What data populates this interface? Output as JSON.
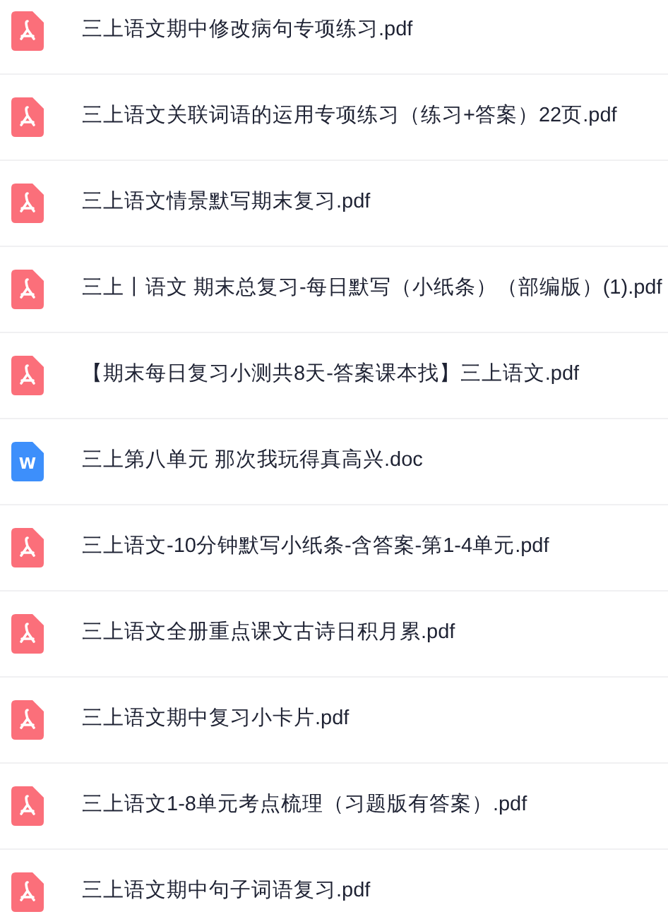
{
  "files": [
    {
      "kind": "pdf",
      "name": "三上语文期中修改病句专项练习.pdf"
    },
    {
      "kind": "pdf",
      "name": "三上语文关联词语的运用专项练习（练习+答案）22页.pdf"
    },
    {
      "kind": "pdf",
      "name": "三上语文情景默写期末复习.pdf"
    },
    {
      "kind": "pdf",
      "name": "三上丨语文 期末总复习-每日默写（小纸条）（部编版）(1).pdf"
    },
    {
      "kind": "pdf",
      "name": "【期末每日复习小测共8天-答案课本找】三上语文.pdf"
    },
    {
      "kind": "doc",
      "icon_text": "W",
      "name": "三上第八单元 那次我玩得真高兴.doc"
    },
    {
      "kind": "pdf",
      "name": "三上语文-10分钟默写小纸条-含答案-第1-4单元.pdf"
    },
    {
      "kind": "pdf",
      "name": "三上语文全册重点课文古诗日积月累.pdf"
    },
    {
      "kind": "pdf",
      "name": "三上语文期中复习小卡片.pdf"
    },
    {
      "kind": "pdf",
      "name": "三上语文1-8单元考点梳理（习题版有答案）.pdf"
    },
    {
      "kind": "pdf",
      "name": "三上语文期中句子词语复习.pdf"
    }
  ]
}
